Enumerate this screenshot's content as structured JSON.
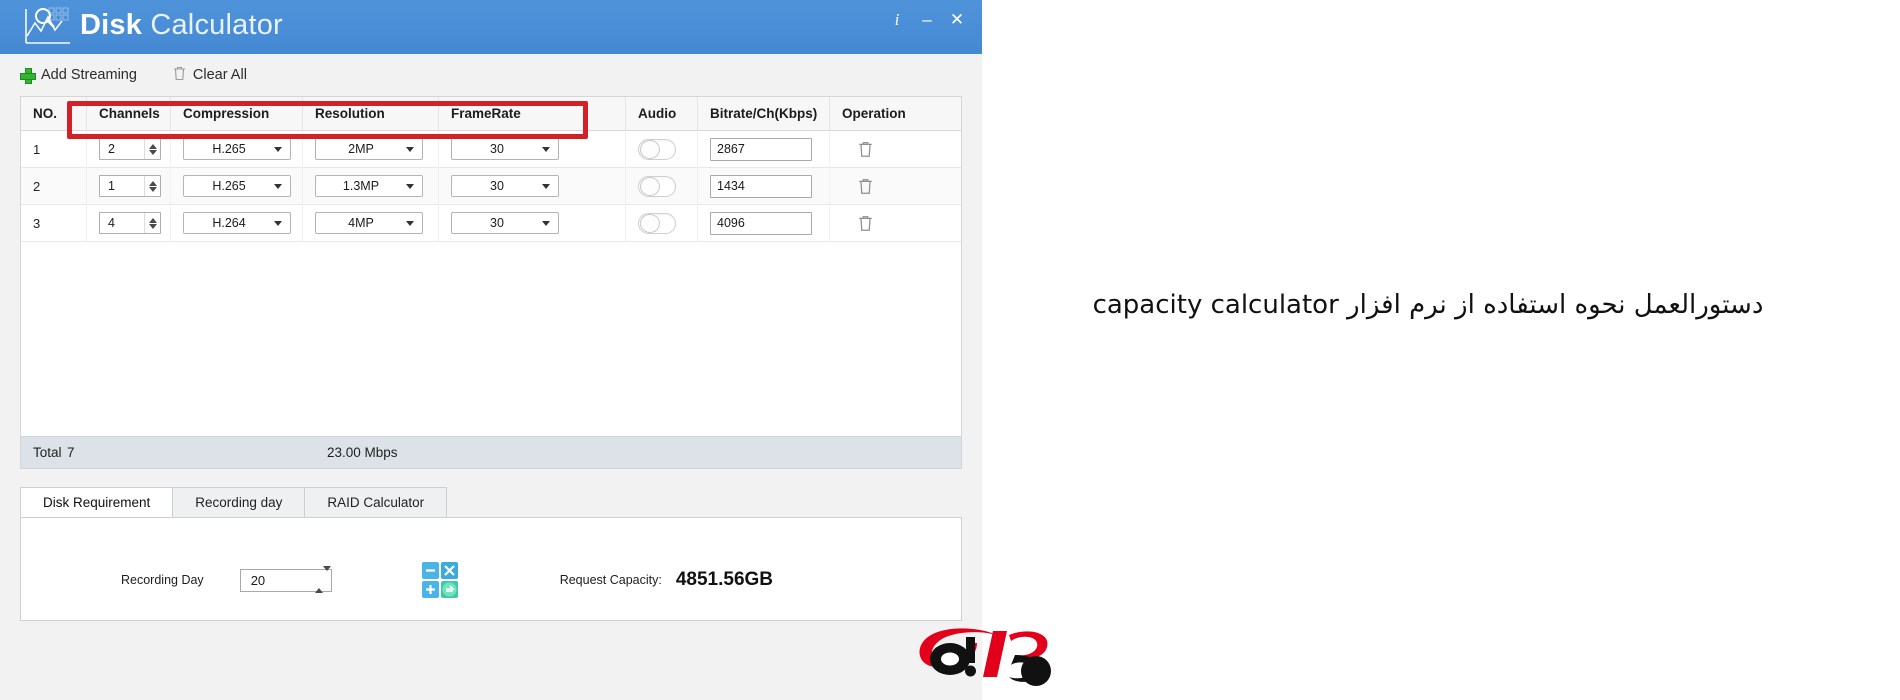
{
  "window": {
    "title_bold": "Disk",
    "title_light": "Calculator",
    "logo_icon": "chart-magnifier-icon",
    "controls": [
      {
        "name": "info-button",
        "glyph": "i"
      },
      {
        "name": "minimize-button",
        "glyph": "–"
      },
      {
        "name": "close-button",
        "glyph": "✕"
      }
    ]
  },
  "toolbar": {
    "add_streaming": "Add Streaming",
    "clear_all": "Clear All",
    "add_icon": "plus-icon",
    "clear_icon": "trash-icon"
  },
  "table": {
    "headers": [
      "NO.",
      "Channels",
      "Compression",
      "Resolution",
      "FrameRate",
      "Audio",
      "Bitrate/Ch(Kbps)",
      "Operation"
    ],
    "rows": [
      {
        "no": "1",
        "channels": "2",
        "compression": "H.265",
        "resolution": "2MP",
        "framerate": "30",
        "audio": false,
        "bitrate": "2867",
        "operation_icon": "trash-icon"
      },
      {
        "no": "2",
        "channels": "1",
        "compression": "H.265",
        "resolution": "1.3MP",
        "framerate": "30",
        "audio": false,
        "bitrate": "1434",
        "operation_icon": "trash-icon"
      },
      {
        "no": "3",
        "channels": "4",
        "compression": "H.264",
        "resolution": "4MP",
        "framerate": "30",
        "audio": false,
        "bitrate": "4096",
        "operation_icon": "trash-icon"
      }
    ]
  },
  "total": {
    "label": "Total",
    "channels": "7",
    "bitrate": "23.00 Mbps"
  },
  "tabs": {
    "items": [
      "Disk Requirement",
      "Recording day",
      "RAID Calculator"
    ],
    "active_index": 0
  },
  "disk_requirement": {
    "recording_day_label": "Recording Day",
    "recording_day_value": "20",
    "calculator_icon": "calculator-icon",
    "request_capacity_label": "Request Capacity:",
    "request_capacity_value": "4851.56GB"
  },
  "annotation": {
    "highlight_color": "#d32128",
    "highlight_name": "red-highlight-box"
  },
  "caption": {
    "text": "دستورالعمل نحوه استفاده از نرم افزار capacity calculator"
  },
  "watermark": {
    "name": "aip-logo"
  },
  "colors": {
    "titlebar": "#4a90d9",
    "accent_red": "#d32128",
    "add_green": "#34b233",
    "total_bar": "#dde2e8"
  }
}
